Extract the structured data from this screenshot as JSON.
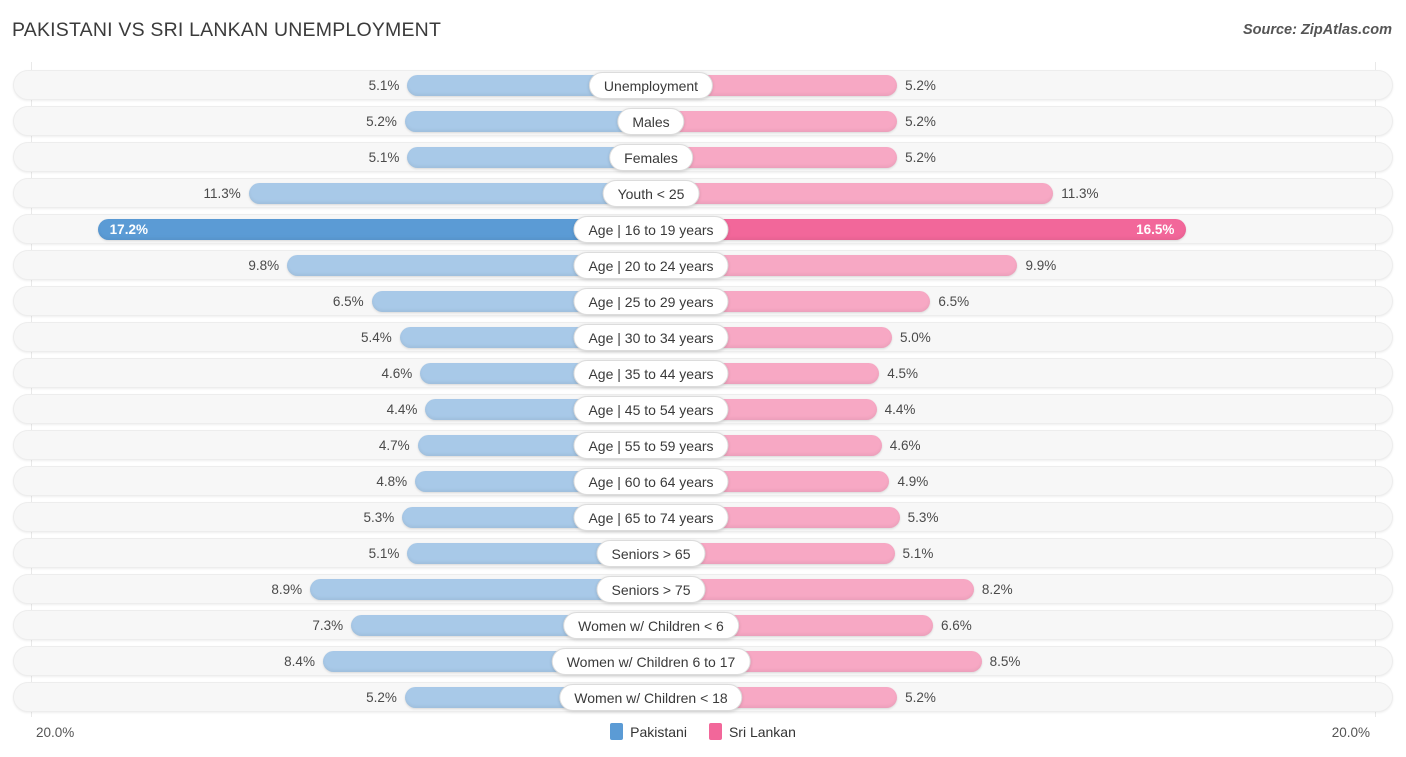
{
  "header": {
    "title": "PAKISTANI VS SRI LANKAN UNEMPLOYMENT",
    "source": "Source: ZipAtlas.com"
  },
  "footer": {
    "axis_left": "20.0%",
    "axis_right": "20.0%",
    "legend": [
      {
        "label": "Pakistani",
        "color": "#5b9bd5"
      },
      {
        "label": "Sri Lankan",
        "color": "#f2679a"
      }
    ]
  },
  "colors": {
    "left_bar": "#a8c9e8",
    "right_bar": "#f7a8c4",
    "left_bar_max": "#5b9bd5",
    "right_bar_max": "#f2679a",
    "row_track": "#f7f7f7",
    "gridline": "#e9e9e9"
  },
  "chart_data": {
    "type": "bar",
    "title": "PAKISTANI VS SRI LANKAN UNEMPLOYMENT",
    "subtitle": "",
    "orientation": "horizontal-diverging",
    "xlabel": "",
    "ylabel": "",
    "xlim": [
      0,
      20.0
    ],
    "axis_max_label": "20.0%",
    "grid": true,
    "legend_position": "bottom-center",
    "categories": [
      "Unemployment",
      "Males",
      "Females",
      "Youth < 25",
      "Age | 16 to 19 years",
      "Age | 20 to 24 years",
      "Age | 25 to 29 years",
      "Age | 30 to 34 years",
      "Age | 35 to 44 years",
      "Age | 45 to 54 years",
      "Age | 55 to 59 years",
      "Age | 60 to 64 years",
      "Age | 65 to 74 years",
      "Seniors > 65",
      "Seniors > 75",
      "Women w/ Children < 6",
      "Women w/ Children 6 to 17",
      "Women w/ Children < 18"
    ],
    "series": [
      {
        "name": "Pakistani",
        "side": "left",
        "color": "#5b9bd5",
        "values": [
          5.1,
          5.2,
          5.1,
          11.3,
          17.2,
          9.8,
          6.5,
          5.4,
          4.6,
          4.4,
          4.7,
          4.8,
          5.3,
          5.1,
          8.9,
          7.3,
          8.4,
          5.2
        ],
        "labels": [
          "5.1%",
          "5.2%",
          "5.1%",
          "11.3%",
          "17.2%",
          "9.8%",
          "6.5%",
          "5.4%",
          "4.6%",
          "4.4%",
          "4.7%",
          "4.8%",
          "5.3%",
          "5.1%",
          "8.9%",
          "7.3%",
          "8.4%",
          "5.2%"
        ]
      },
      {
        "name": "Sri Lankan",
        "side": "right",
        "color": "#f2679a",
        "values": [
          5.2,
          5.2,
          5.2,
          11.3,
          16.5,
          9.9,
          6.5,
          5.0,
          4.5,
          4.4,
          4.6,
          4.9,
          5.3,
          5.1,
          8.2,
          6.6,
          8.5,
          5.2
        ],
        "labels": [
          "5.2%",
          "5.2%",
          "5.2%",
          "11.3%",
          "16.5%",
          "9.9%",
          "6.5%",
          "5.0%",
          "4.5%",
          "4.4%",
          "4.6%",
          "4.9%",
          "5.3%",
          "5.1%",
          "8.2%",
          "6.6%",
          "8.5%",
          "5.2%"
        ]
      }
    ],
    "highlighted_row_index": 4
  }
}
